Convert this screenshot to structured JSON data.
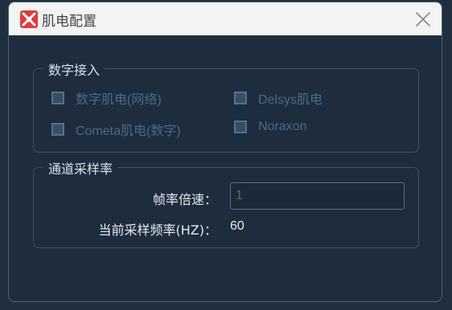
{
  "window": {
    "title": "肌电配置",
    "icon": "app-logo-icon",
    "close_icon": "close-icon"
  },
  "colors": {
    "background": "#1e2d3d",
    "titlebar": "#f3f3f3",
    "accent": "#e23a3a",
    "disabled_text": "#4f6884"
  },
  "digital_input": {
    "title": "数字接入",
    "options": [
      {
        "label": "数字肌电(网络)",
        "checked": false,
        "enabled": false
      },
      {
        "label": "Delsys肌电",
        "checked": false,
        "enabled": false
      },
      {
        "label": "Cometa肌电(数字)",
        "checked": false,
        "enabled": false
      },
      {
        "label": "Noraxon",
        "checked": false,
        "enabled": false
      }
    ]
  },
  "channel_sampling": {
    "title": "通道采样率",
    "frame_rate_label": "帧率倍速：",
    "frame_rate_value": "1",
    "current_rate_label": "当前采样频率(HZ)：",
    "current_rate_value": "60"
  }
}
